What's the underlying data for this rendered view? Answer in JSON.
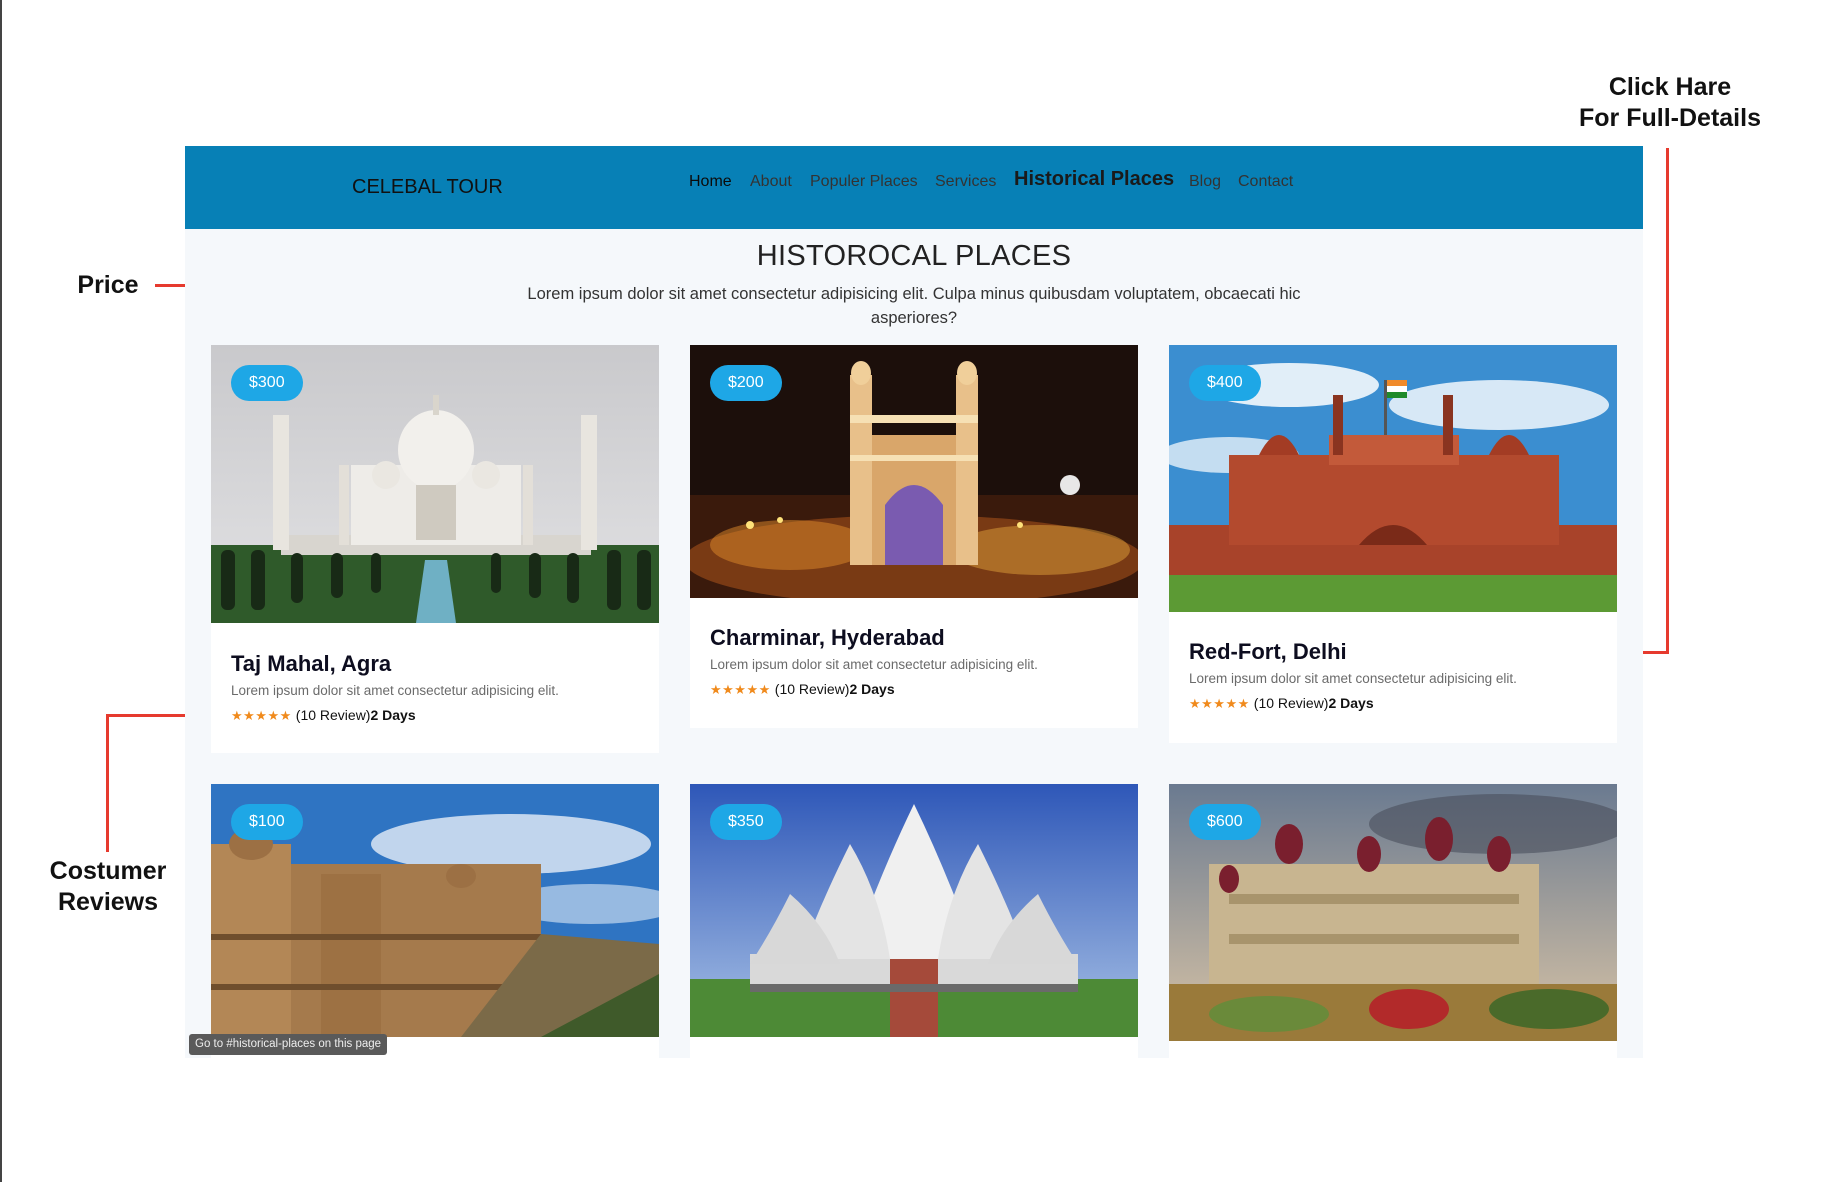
{
  "annotations": {
    "price": "Price",
    "reviews_line1": "Costumer",
    "reviews_line2": "Reviews",
    "details_line1": "Click Hare",
    "details_line2": "For Full-Details"
  },
  "navbar": {
    "brand": "CELEBAL TOUR",
    "items": [
      {
        "label": "Home"
      },
      {
        "label": "About"
      },
      {
        "label": "Populer Places"
      },
      {
        "label": "Services"
      },
      {
        "label": "Historical Places"
      },
      {
        "label": "Blog"
      },
      {
        "label": "Contact"
      }
    ]
  },
  "section": {
    "title": "HISTOROCAL PLACES",
    "subtitle": "Lorem ipsum dolor sit amet consectetur adipisicing elit. Culpa minus quibusdam voluptatem, obcaecati hic asperiores?"
  },
  "cards": [
    {
      "price": "$300",
      "title": "Taj Mahal, Agra",
      "desc": "Lorem ipsum dolor sit amet consectetur adipisicing elit.",
      "stars": "★★★★★",
      "reviews": "(10 Review)",
      "days": "2 Days"
    },
    {
      "price": "$200",
      "title": "Charminar, Hyderabad",
      "desc": "Lorem ipsum dolor sit amet consectetur adipisicing elit.",
      "stars": "★★★★★",
      "reviews": "(10 Review)",
      "days": "2 Days"
    },
    {
      "price": "$400",
      "title": "Red-Fort, Delhi",
      "desc": "Lorem ipsum dolor sit amet consectetur adipisicing elit.",
      "stars": "★★★★★",
      "reviews": "(10 Review)",
      "days": "2 Days"
    },
    {
      "price": "$100"
    },
    {
      "price": "$350"
    },
    {
      "price": "$600"
    }
  ],
  "status_tooltip": "Go to #historical-places on this page",
  "colors": {
    "navbar": "#0780b6",
    "price_badge": "#1ea7e6",
    "annotation_line": "#e63a2e",
    "stars": "#f08a1c"
  }
}
